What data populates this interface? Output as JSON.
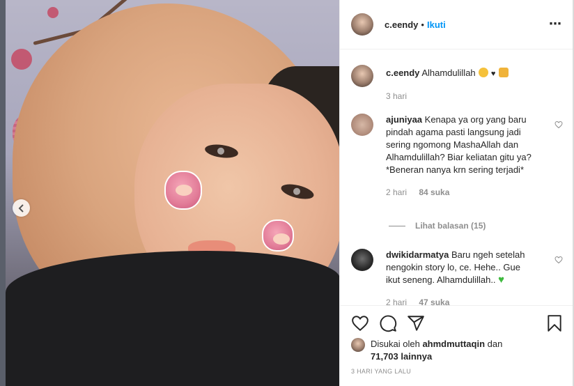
{
  "post": {
    "username": "c.eendy",
    "separator": "•",
    "follow_label": "Ikuti",
    "more_label": "•••"
  },
  "caption": {
    "username": "c.eendy",
    "text": "Alhamdulillah",
    "age": "3 hari"
  },
  "comments": [
    {
      "username": "ajuniyaa",
      "text": "Kenapa ya org yang baru pindah agama pasti langsung jadi sering ngomong MashaAllah dan Alhamdulillah? Biar keliatan gitu ya? *Beneran nanya krn sering terjadi*",
      "age": "2 hari",
      "likes": "84 suka",
      "replies_label": "Lihat balasan (15)"
    },
    {
      "username": "dwikidarmatya",
      "text": "Baru ngeh setelah nengokin story lo, ce. Hehe.. Gue ikut seneng. Alhamdulillah..",
      "age": "2 hari",
      "likes": "47 suka"
    }
  ],
  "liked_by": {
    "prefix": "Disukai oleh",
    "user": "ahmdmuttaqin",
    "conj": "dan",
    "count": "71,703 lainnya"
  },
  "timestamp": "3 HARI YANG LALU",
  "icons": {
    "more": "more-options-icon",
    "heart": "heart-icon",
    "comment": "comment-icon",
    "share": "share-icon",
    "save": "bookmark-icon",
    "prev": "chevron-left-icon"
  },
  "colors": {
    "link": "#0095f6",
    "text": "#262626",
    "muted": "#8e8e8e",
    "border": "#efefef"
  }
}
